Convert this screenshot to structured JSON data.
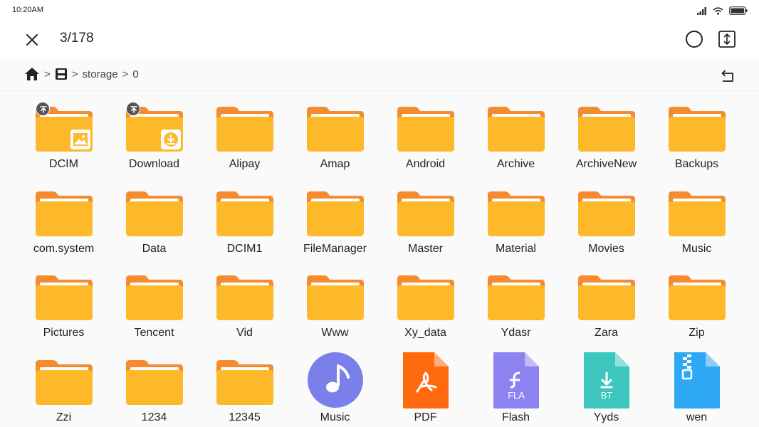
{
  "status": {
    "time": "10:20AM"
  },
  "header": {
    "title": "3/178"
  },
  "breadcrumb": {
    "items": [
      "storage",
      "0"
    ],
    "separator": ">"
  },
  "colors": {
    "folder_tab": "#F58A2F",
    "folder_body": "#FDB92A",
    "music": "#7B7FEA",
    "pdf": "#FF6A0F",
    "flash": "#8C82F2",
    "bt": "#3CC6BD",
    "zip": "#2EA7F4"
  },
  "files": [
    {
      "name": "DCIM",
      "type": "folder",
      "badge": true,
      "overlay": "image-icon"
    },
    {
      "name": "Download",
      "type": "folder",
      "badge": true,
      "overlay": "download-icon"
    },
    {
      "name": "Alipay",
      "type": "folder"
    },
    {
      "name": "Amap",
      "type": "folder"
    },
    {
      "name": "Android",
      "type": "folder"
    },
    {
      "name": "Archive",
      "type": "folder"
    },
    {
      "name": "ArchiveNew",
      "type": "folder"
    },
    {
      "name": "Backups",
      "type": "folder"
    },
    {
      "name": "com.system",
      "type": "folder"
    },
    {
      "name": "Data",
      "type": "folder"
    },
    {
      "name": "DCIM1",
      "type": "folder"
    },
    {
      "name": "FileManager",
      "type": "folder"
    },
    {
      "name": "Master",
      "type": "folder"
    },
    {
      "name": "Material",
      "type": "folder"
    },
    {
      "name": "Movies",
      "type": "folder"
    },
    {
      "name": "Music",
      "type": "folder"
    },
    {
      "name": "Pictures",
      "type": "folder"
    },
    {
      "name": "Tencent",
      "type": "folder"
    },
    {
      "name": "Vid",
      "type": "folder"
    },
    {
      "name": "Www",
      "type": "folder"
    },
    {
      "name": "Xy_data",
      "type": "folder"
    },
    {
      "name": "Ydasr",
      "type": "folder"
    },
    {
      "name": "Zara",
      "type": "folder"
    },
    {
      "name": "Zip",
      "type": "folder"
    },
    {
      "name": "Zzi",
      "type": "folder"
    },
    {
      "name": "1234",
      "type": "folder"
    },
    {
      "name": "12345",
      "type": "folder"
    },
    {
      "name": "Music",
      "type": "music",
      "icon": "music-note-icon"
    },
    {
      "name": "PDF",
      "type": "pdf",
      "icon": "pdf-icon"
    },
    {
      "name": "Flash",
      "type": "flash",
      "icon": "flash-icon",
      "icon_text": "FLA"
    },
    {
      "name": "Yyds",
      "type": "bt",
      "icon": "torrent-icon",
      "icon_text": "BT"
    },
    {
      "name": "wen",
      "type": "zip",
      "icon": "zip-icon"
    }
  ]
}
